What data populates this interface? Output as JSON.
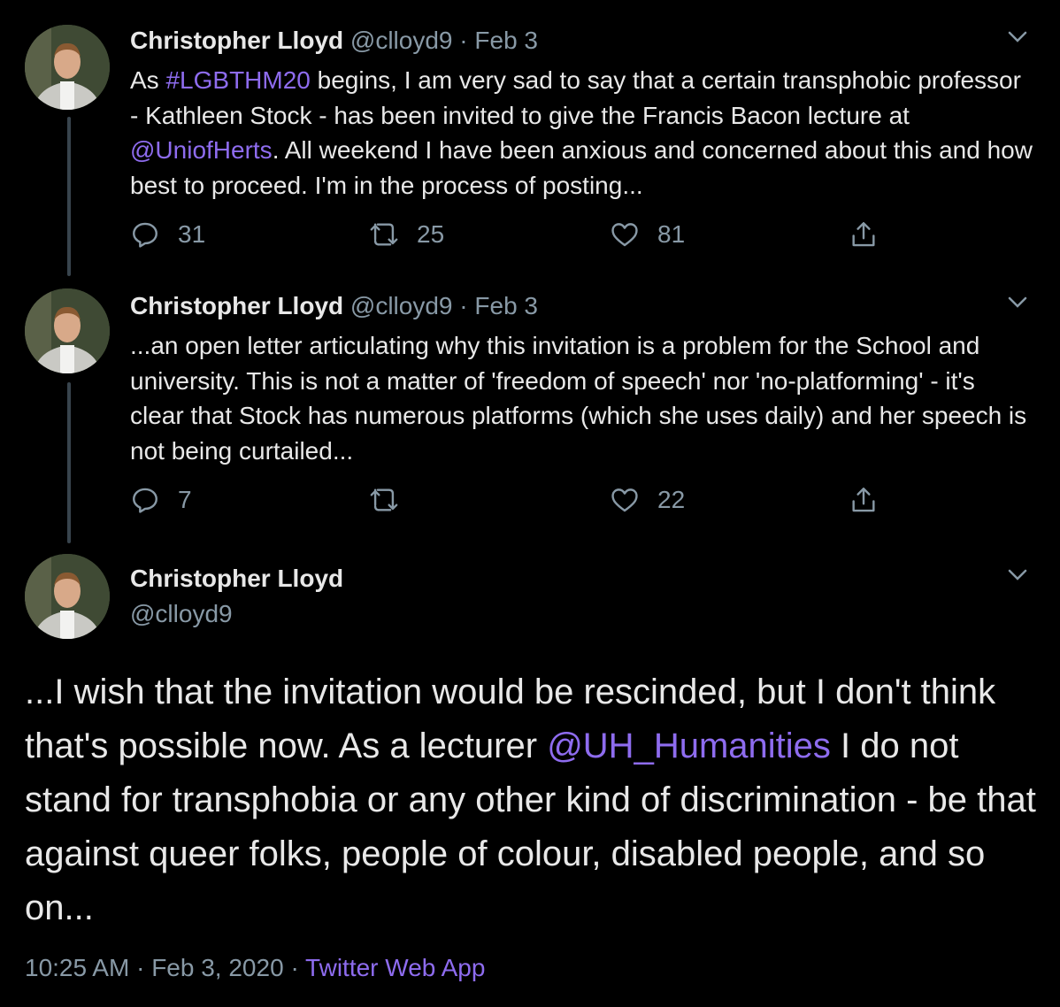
{
  "tweets": [
    {
      "name": "Christopher Lloyd",
      "handle": "@clloyd9",
      "separator": "·",
      "date": "Feb 3",
      "text_parts": [
        "As ",
        "#LGBTHM20",
        " begins, I am very sad to say that a certain transphobic professor - Kathleen Stock - has been invited to give the Francis Bacon lecture at ",
        "@UniofHerts",
        ". All weekend I have been anxious and concerned about this and how best to proceed. I'm in the process of posting..."
      ],
      "replies": "31",
      "retweets": "25",
      "likes": "81"
    },
    {
      "name": "Christopher Lloyd",
      "handle": "@clloyd9",
      "separator": "·",
      "date": "Feb 3",
      "text": "...an open letter articulating why this invitation is a problem for the School and university. This is not a matter of 'freedom of speech' nor 'no-platforming' - it's clear that Stock has numerous platforms (which she uses daily) and her speech is not being curtailed...",
      "replies": "7",
      "retweets": "",
      "likes": "22"
    }
  ],
  "main_tweet": {
    "name": "Christopher Lloyd",
    "handle": "@clloyd9",
    "text_parts": [
      "...I wish that the invitation would be rescinded, but I don't think that's possible now. As a lecturer ",
      "@UH_Humanities",
      " I do not stand for transphobia or any other kind of discrimination - be that against queer folks, people of colour, disabled people, and so on..."
    ],
    "time": "10:25 AM",
    "separator": "·",
    "date": "Feb 3, 2020",
    "app": "Twitter Web App"
  },
  "icons": [
    "reply-icon",
    "retweet-icon",
    "like-icon",
    "share-icon",
    "chevron-down-icon"
  ],
  "colors": {
    "background": "#000000",
    "text": "#e8e8e8",
    "muted": "#8899a6",
    "link": "#8e6cef",
    "thread_line": "#38444d"
  }
}
